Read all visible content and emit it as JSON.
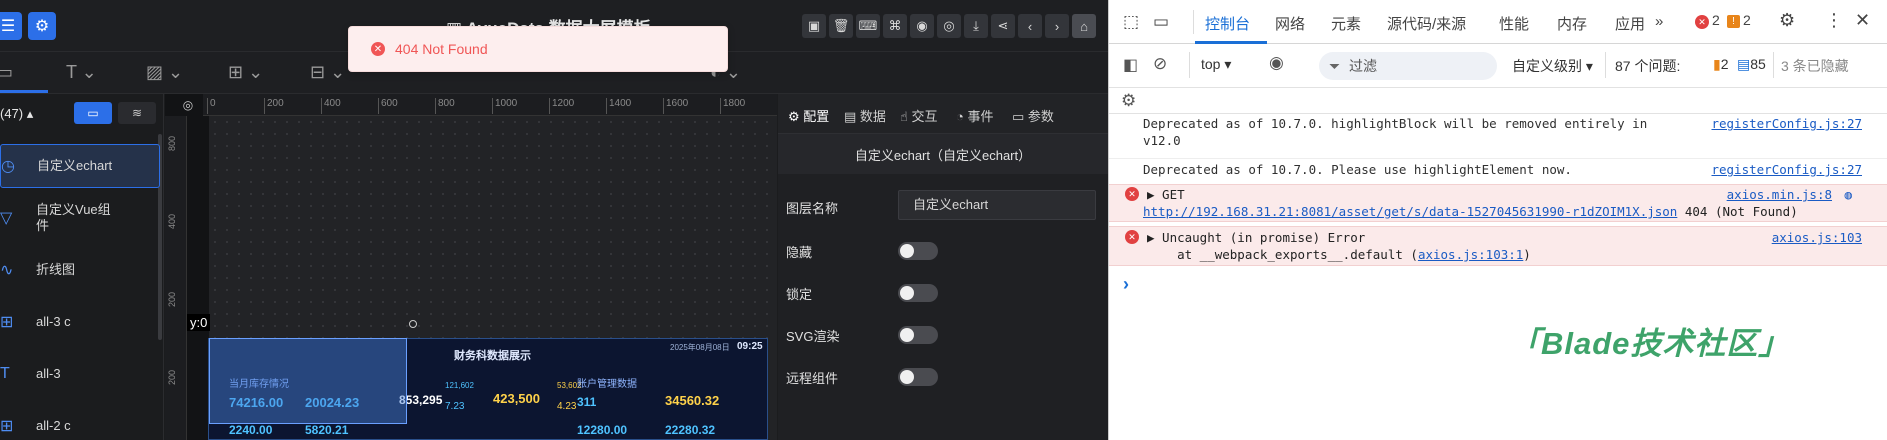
{
  "app": {
    "title": "AvueData 数据大屏模板",
    "zoom_buttons": [
      "y:0"
    ],
    "layer_count_label": "(47)",
    "layers": [
      {
        "label": "自定义echart",
        "icon": "chart-icon",
        "selected": true
      },
      {
        "label": "自定义Vue组件",
        "icon": "vue-icon",
        "selected": false
      },
      {
        "label": "折线图",
        "icon": "line-chart-icon",
        "selected": false
      },
      {
        "label": "all-3 c",
        "icon": "grid-icon",
        "selected": false
      },
      {
        "label": "all-3",
        "icon": "text-icon",
        "selected": false
      },
      {
        "label": "all-2 c",
        "icon": "grid-icon",
        "selected": false
      }
    ],
    "ruler_ticks": [
      "0",
      "200",
      "400",
      "600",
      "800",
      "1000",
      "1200",
      "1400",
      "1600",
      "1800"
    ],
    "ruler_left_ticks": [
      "800",
      "400",
      "200",
      "200"
    ],
    "preview": {
      "title": "财务科数据展示",
      "date": "2025年08月08日",
      "time": "09:25",
      "left_heading": "当月库存情况",
      "left_values": [
        "74216.00",
        "20024.23",
        "2240.00",
        "5820.21"
      ],
      "mid_values": [
        "853,295",
        "423,500",
        "7.23",
        "4.23",
        "121,602",
        "53,602"
      ],
      "right_heading": "账户管理数据",
      "right_values": [
        "311",
        "34560.32",
        "12280.00",
        "22280.32"
      ]
    }
  },
  "props": {
    "tabs": [
      "配置",
      "数据",
      "交互",
      "事件",
      "参数"
    ],
    "title": "自定义echart（自定义echart）",
    "fields": [
      {
        "label": "图层名称",
        "value": "自定义echart"
      },
      {
        "label": "隐藏"
      },
      {
        "label": "锁定"
      },
      {
        "label": "SVG渲染"
      },
      {
        "label": "远程组件"
      }
    ]
  },
  "toast": {
    "message": "404 Not Found"
  },
  "devtools": {
    "tabs": [
      "控制台",
      "网络",
      "元素",
      "源代码/来源",
      "性能",
      "内存",
      "应用"
    ],
    "error_count": "2",
    "warn_count": "2",
    "context": "top",
    "filter_placeholder": "过滤",
    "level": "自定义级别",
    "issues_label": "87 个问题:",
    "issues_warn": "2",
    "issues_info": "85",
    "hidden": "3 条已隐藏",
    "lines": [
      {
        "type": "warn",
        "text": "Deprecated as of 10.7.0. highlightBlock will be removed entirely in",
        "text2": "v12.0",
        "source": "registerConfig.js:27"
      },
      {
        "type": "log",
        "text": "Deprecated as of 10.7.0. Please use highlightElement now.",
        "source": "registerConfig.js:27"
      },
      {
        "type": "error",
        "text": "▶ GET",
        "url": "http://192.168.31.21:8081/asset/get/s/data-1527045631990-r1dZOIM1X.json",
        "status": " 404 (Not Found)",
        "source": "axios.min.js:8"
      },
      {
        "type": "error",
        "text": "▶ Uncaught (in promise) Error",
        "text2": "    at __webpack_exports__.default (",
        "link2": "axios.js:103:1",
        "tail": ")",
        "source": "axios.js:103"
      }
    ],
    "prompt": "›",
    "watermark": "「Blade技术社区」"
  }
}
